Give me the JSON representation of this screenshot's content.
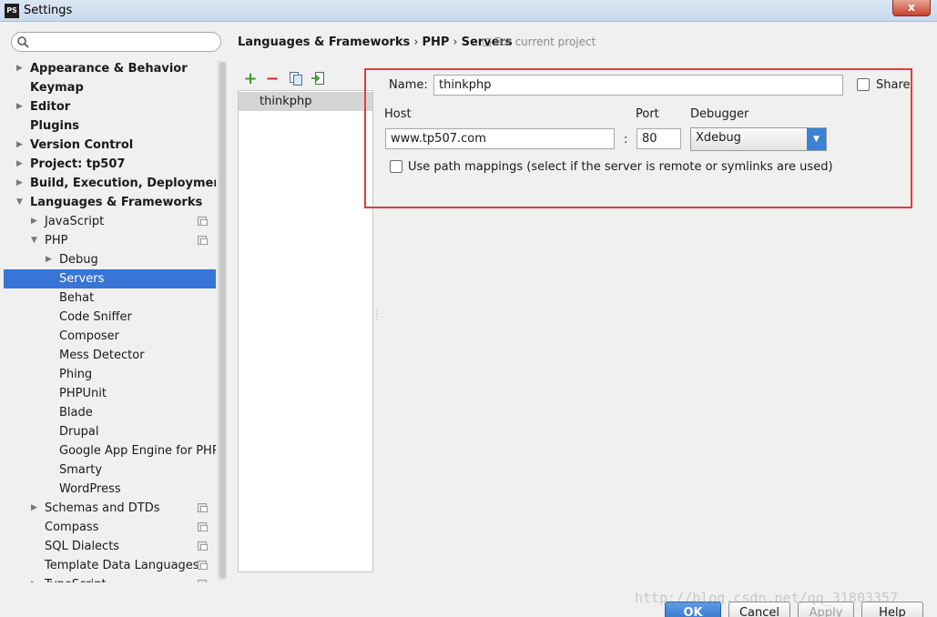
{
  "window": {
    "title": "Settings",
    "app_icon": "PS",
    "close_label": "x"
  },
  "search": {
    "placeholder": "",
    "value": ""
  },
  "tree": [
    {
      "label": "Appearance & Behavior",
      "bold": true,
      "arrow": "right"
    },
    {
      "label": "Keymap",
      "bold": true,
      "arrow": ""
    },
    {
      "label": "Editor",
      "bold": true,
      "arrow": "right"
    },
    {
      "label": "Plugins",
      "bold": true,
      "arrow": ""
    },
    {
      "label": "Version Control",
      "bold": true,
      "arrow": "right"
    },
    {
      "label": "Project: tp507",
      "bold": true,
      "arrow": "right"
    },
    {
      "label": "Build, Execution, Deployment",
      "bold": true,
      "arrow": "right"
    },
    {
      "label": "Languages & Frameworks",
      "bold": true,
      "arrow": "down"
    },
    {
      "label": "JavaScript",
      "bold": false,
      "arrow": "right",
      "project_icon": true
    },
    {
      "label": "PHP",
      "bold": false,
      "arrow": "down",
      "project_icon": true
    },
    {
      "label": "Debug",
      "bold": false,
      "arrow": "right"
    },
    {
      "label": "Servers",
      "bold": false,
      "arrow": "",
      "selected": true
    },
    {
      "label": "Behat",
      "bold": false,
      "arrow": ""
    },
    {
      "label": "Code Sniffer",
      "bold": false,
      "arrow": ""
    },
    {
      "label": "Composer",
      "bold": false,
      "arrow": ""
    },
    {
      "label": "Mess Detector",
      "bold": false,
      "arrow": ""
    },
    {
      "label": "Phing",
      "bold": false,
      "arrow": ""
    },
    {
      "label": "PHPUnit",
      "bold": false,
      "arrow": ""
    },
    {
      "label": "Blade",
      "bold": false,
      "arrow": ""
    },
    {
      "label": "Drupal",
      "bold": false,
      "arrow": ""
    },
    {
      "label": "Google App Engine for PHP",
      "bold": false,
      "arrow": ""
    },
    {
      "label": "Smarty",
      "bold": false,
      "arrow": ""
    },
    {
      "label": "WordPress",
      "bold": false,
      "arrow": ""
    },
    {
      "label": "Schemas and DTDs",
      "bold": false,
      "arrow": "right",
      "project_icon": true
    },
    {
      "label": "Compass",
      "bold": false,
      "arrow": "",
      "project_icon": true
    },
    {
      "label": "SQL Dialects",
      "bold": false,
      "arrow": "",
      "project_icon": true
    },
    {
      "label": "Template Data Languages",
      "bold": false,
      "arrow": "",
      "project_icon": true
    },
    {
      "label": "TypeScript",
      "bold": false,
      "arrow": "right",
      "project_icon": true
    }
  ],
  "breadcrumb": {
    "part1": "Languages & Frameworks",
    "part2": "PHP",
    "part3": "Servers",
    "separator": "›",
    "note": "For current project"
  },
  "toolbar": {
    "add": "+",
    "remove": "−"
  },
  "servers": [
    "thinkphp"
  ],
  "form": {
    "name_label": "Name:",
    "name_value": "thinkphp",
    "shared_label": "Shared",
    "host_label": "Host",
    "host_value": "www.tp507.com",
    "colon": ":",
    "port_label": "Port",
    "port_value": "80",
    "debugger_label": "Debugger",
    "debugger_value": "Xdebug",
    "path_mappings_label": "Use path mappings (select if the server is remote or symlinks are used)"
  },
  "buttons": {
    "ok": "OK",
    "cancel": "Cancel",
    "apply": "Apply",
    "help": "Help"
  },
  "watermark": "http://blog.csdn.net/qq_31803357",
  "colors": {
    "selection": "#3875d7",
    "highlight_box": "#e23c3c",
    "add_icon": "#3a9a2e",
    "remove_icon": "#d12b2b"
  }
}
